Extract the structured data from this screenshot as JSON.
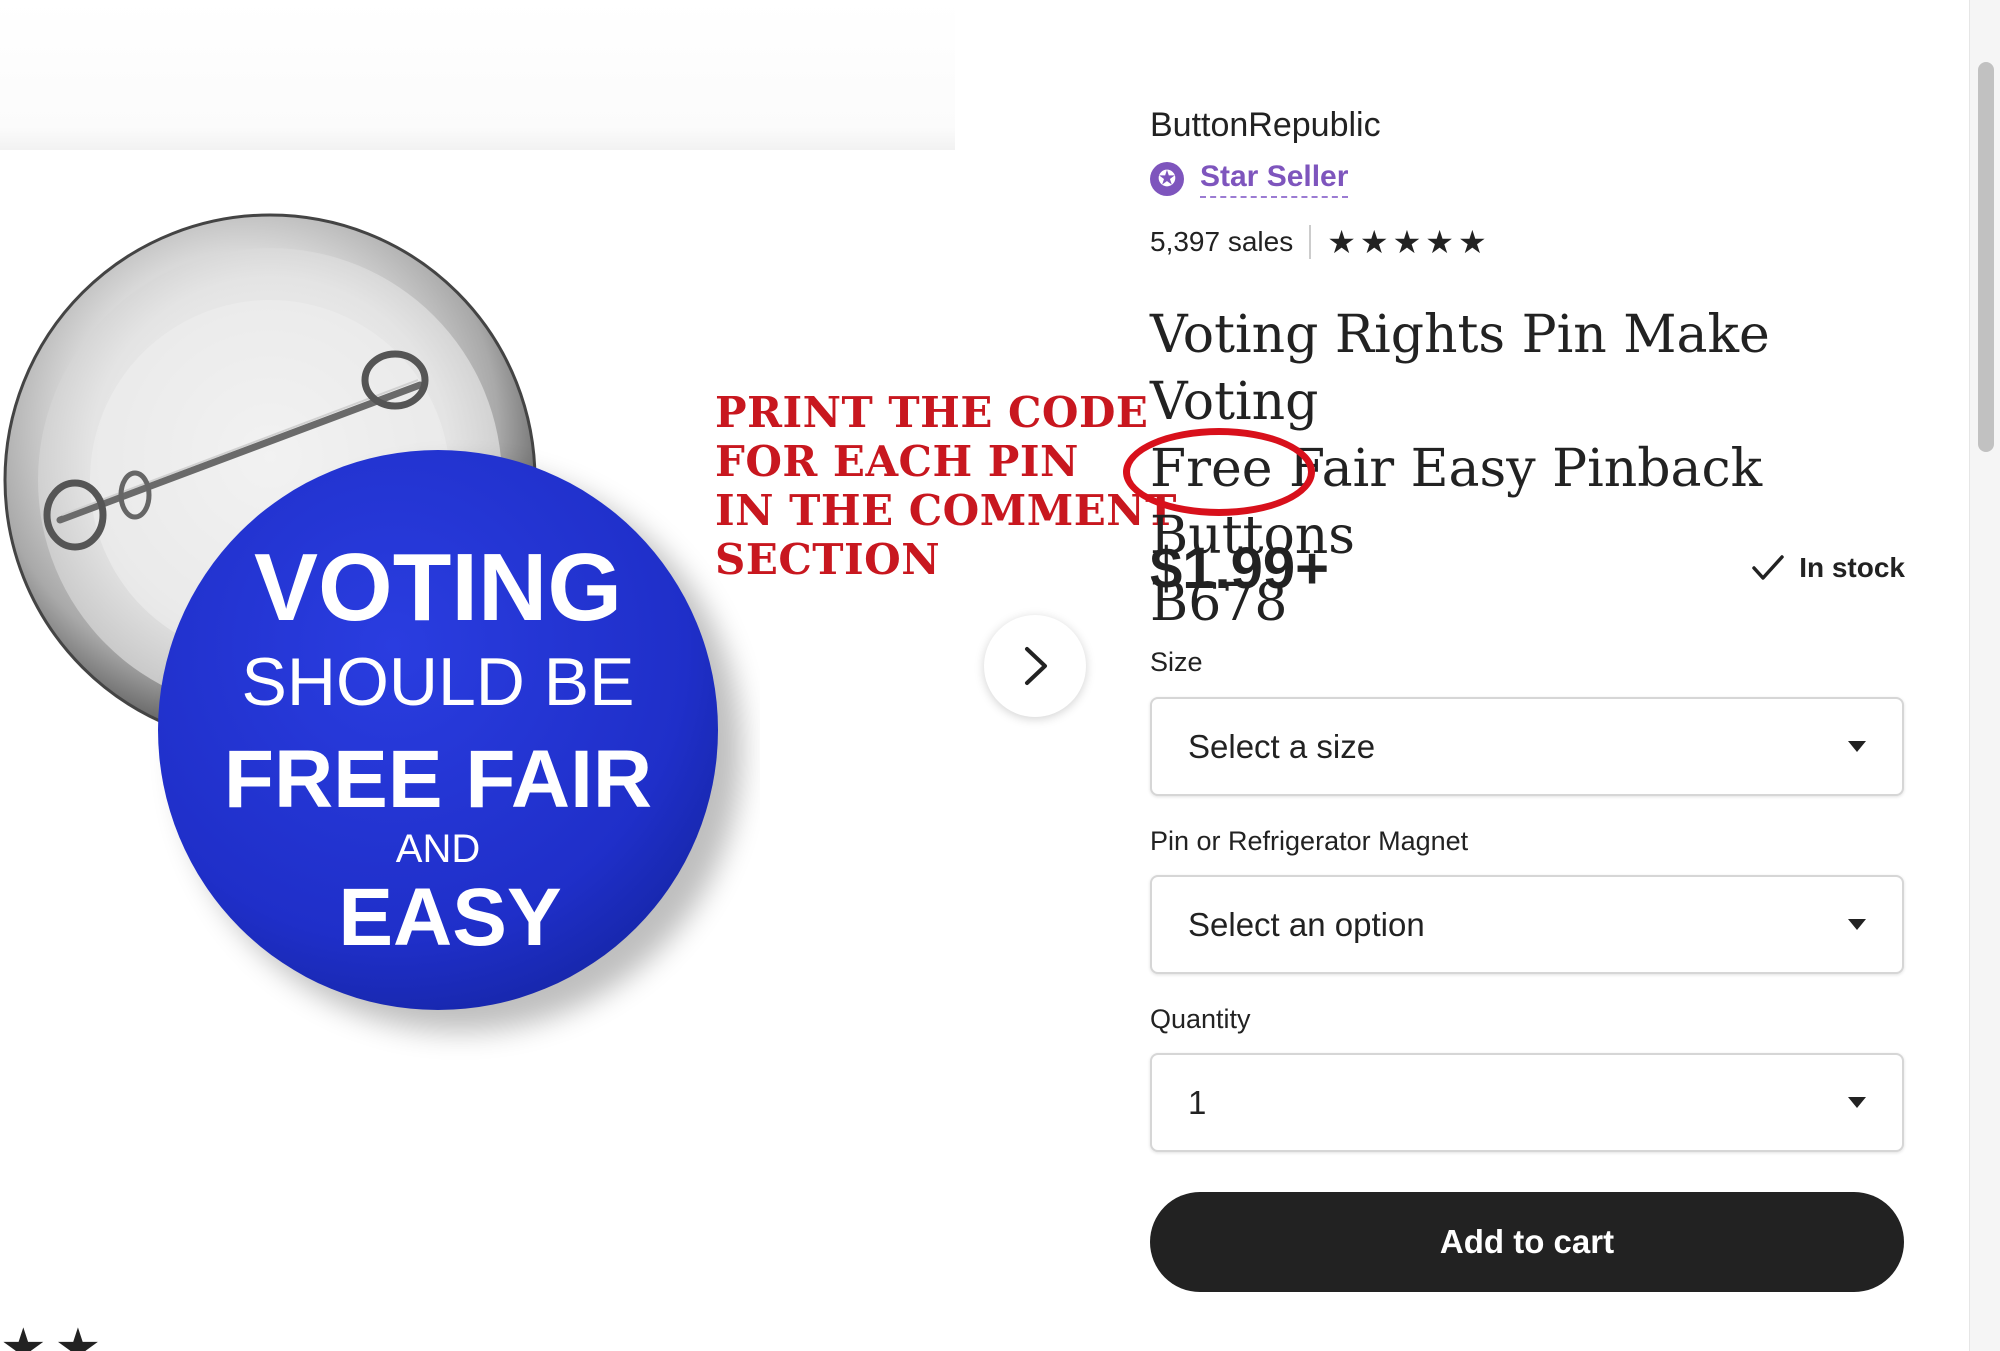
{
  "product_image": {
    "pin_lines": [
      "VOTING",
      "SHOULD BE",
      "FREE FAIR",
      "AND",
      "EASY"
    ],
    "pin_color": "#1f2fc9",
    "next_icon": "chevron-right-icon"
  },
  "annotation": {
    "lines": [
      "PRINT THE CODE",
      "FOR EACH PIN",
      "IN THE COMMENT",
      "SECTION"
    ],
    "color": "#c8171f"
  },
  "shop": {
    "name": "ButtonRepublic",
    "badge_icon": "star-seller-icon",
    "badge_label": "Star Seller",
    "sales": "5,397 sales",
    "rating_stars": "★★★★★",
    "rating": 5
  },
  "product": {
    "title_line1": "Voting Rights Pin Make Voting",
    "title_line2": "Free Fair Easy Pinback Buttons",
    "title_line3": "B678",
    "price": "$1.99+",
    "stock_status": "In stock"
  },
  "options": {
    "size_label": "Size",
    "size_value": "Select a size",
    "type_label": "Pin or Refrigerator Magnet",
    "type_value": "Select an option",
    "quantity_label": "Quantity",
    "quantity_value": "1"
  },
  "cart": {
    "button_label": "Add to cart"
  },
  "bottom": {
    "stars": "★★"
  },
  "colors": {
    "accent_purple": "#7e55bd",
    "text": "#222222",
    "button_bg": "#222222",
    "annotation_red": "#d8101b"
  }
}
